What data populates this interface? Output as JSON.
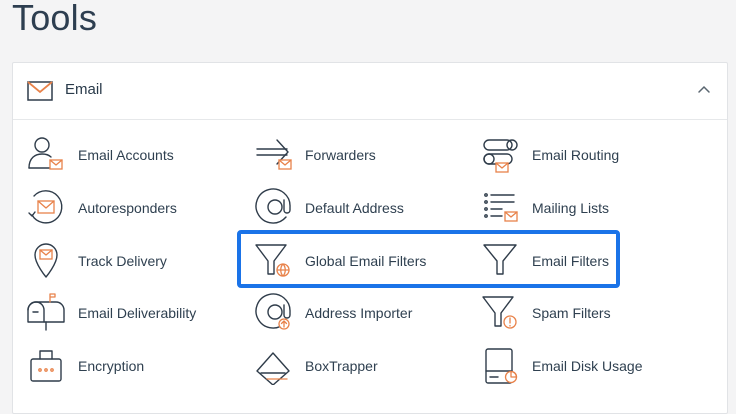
{
  "page": {
    "title": "Tools"
  },
  "email_section": {
    "title": "Email",
    "icon": "envelope-icon",
    "toggle_icon": "chevron-up-icon"
  },
  "tools": [
    {
      "label": "Email Accounts",
      "icon": "user-email-icon"
    },
    {
      "label": "Forwarders",
      "icon": "forward-arrow-icon"
    },
    {
      "label": "Email Routing",
      "icon": "routing-switch-icon"
    },
    {
      "label": "Autoresponders",
      "icon": "autoresponder-icon"
    },
    {
      "label": "Default Address",
      "icon": "at-sign-icon"
    },
    {
      "label": "Mailing Lists",
      "icon": "mailing-list-icon"
    },
    {
      "label": "Track Delivery",
      "icon": "map-pin-icon"
    },
    {
      "label": "Global Email Filters",
      "icon": "global-filter-icon"
    },
    {
      "label": "Email Filters",
      "icon": "funnel-icon"
    },
    {
      "label": "Email Deliverability",
      "icon": "mailbox-icon"
    },
    {
      "label": "Address Importer",
      "icon": "address-importer-icon"
    },
    {
      "label": "Spam Filters",
      "icon": "spam-filter-icon"
    },
    {
      "label": "Encryption",
      "icon": "lock-box-icon"
    },
    {
      "label": "BoxTrapper",
      "icon": "box-trapper-icon"
    },
    {
      "label": "Email Disk Usage",
      "icon": "disk-usage-icon"
    }
  ],
  "colors": {
    "accent_orange": "#e8824a",
    "highlight_blue": "#1a73e8",
    "icon_stroke": "#2f3c4a"
  }
}
